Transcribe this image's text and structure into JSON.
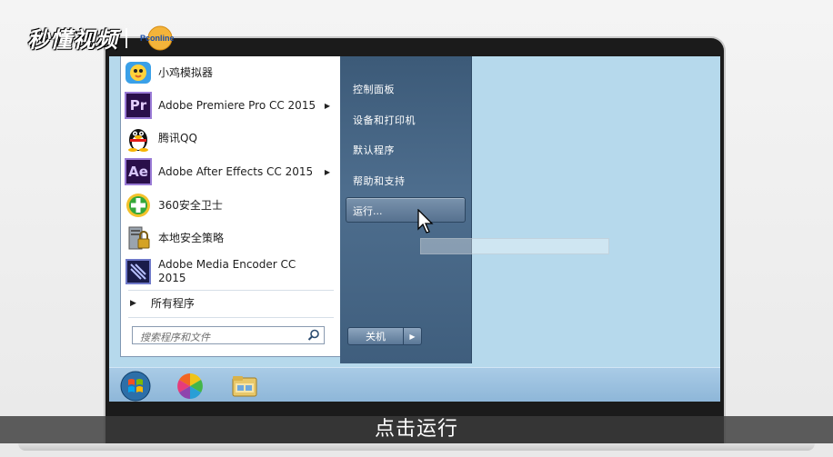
{
  "watermark": {
    "brand_text": "秒懂视频",
    "partner_text": "Pconline"
  },
  "start_menu": {
    "programs": [
      {
        "label": "小鸡模拟器",
        "icon": "chick-emulator-icon",
        "has_submenu": false
      },
      {
        "label": "Adobe Premiere Pro CC 2015",
        "icon": "premiere-pro-icon",
        "icon_text": "Pr",
        "has_submenu": true
      },
      {
        "label": "腾讯QQ",
        "icon": "qq-penguin-icon",
        "has_submenu": false
      },
      {
        "label": "Adobe After Effects CC 2015",
        "icon": "after-effects-icon",
        "icon_text": "Ae",
        "has_submenu": true
      },
      {
        "label": "360安全卫士",
        "icon": "360-security-icon",
        "has_submenu": false
      },
      {
        "label": "本地安全策略",
        "icon": "local-security-policy-icon",
        "has_submenu": false
      },
      {
        "label": "Adobe Media Encoder CC 2015",
        "icon": "media-encoder-icon",
        "has_submenu": false
      }
    ],
    "all_programs_label": "所有程序",
    "search_placeholder": "搜索程序和文件",
    "right_items": {
      "control_panel": "控制面板",
      "devices_printers": "设备和打印机",
      "default_programs": "默认程序",
      "help_support": "帮助和支持",
      "run": "运行..."
    },
    "shutdown_label": "关机"
  },
  "subtitle": "点击运行",
  "colors": {
    "screen_bg": "#b6d9ec",
    "menu_right_bg": "#4e6e8e",
    "premiere_purple": "#2a0f4a",
    "after_effects_purple": "#2a0f4a"
  }
}
